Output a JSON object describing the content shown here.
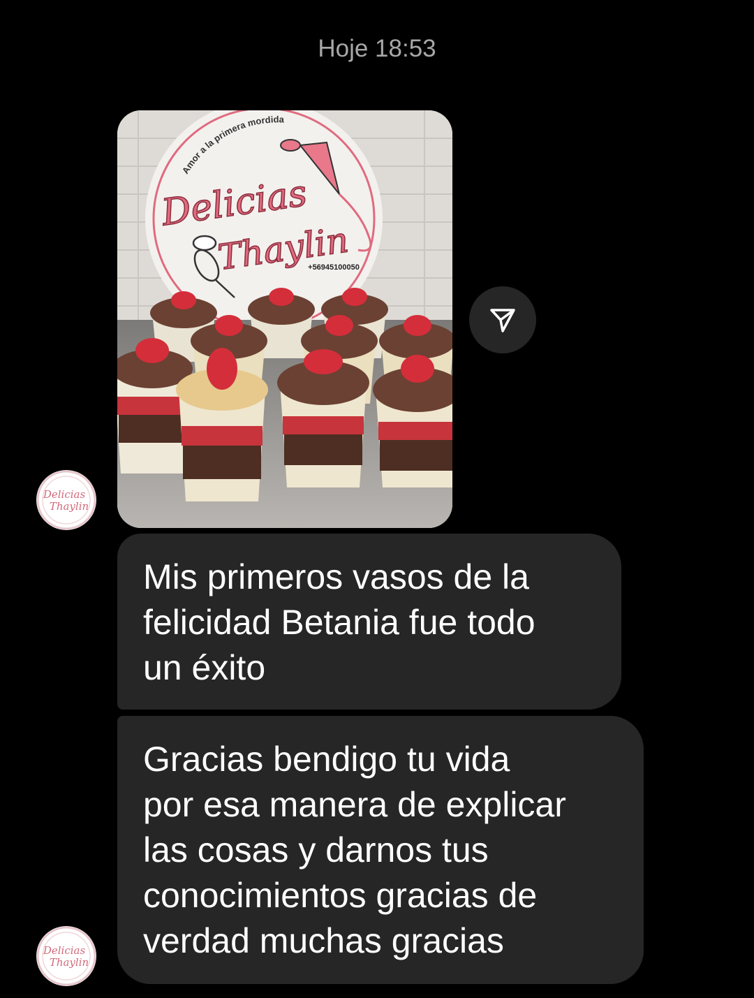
{
  "thread": {
    "timestamp": "Hoje 18:53"
  },
  "colors": {
    "background": "#000000",
    "bubble": "#262626",
    "timestamp_text": "#a8a8a8",
    "message_text": "#ffffff",
    "brand_pink": "#e06b7f"
  },
  "photo_message": {
    "sign": {
      "top_text": "Amor a la primera mordida",
      "brand_line1": "Delicias",
      "brand_line2": "Thaylin",
      "phone": "+56945100050"
    },
    "share_icon": "send-icon"
  },
  "sender": {
    "avatar_line1": "Delicias",
    "avatar_line2": "Thaylin"
  },
  "messages": [
    {
      "lines": [
        "Mis primeros vasos de la",
        "felicidad Betania fue todo",
        "un éxito"
      ]
    },
    {
      "lines": [
        "Gracias bendigo tu vida",
        "por esa manera de explicar",
        "las cosas y darnos tus",
        "conocimientos gracias de",
        "verdad muchas gracias"
      ]
    }
  ]
}
